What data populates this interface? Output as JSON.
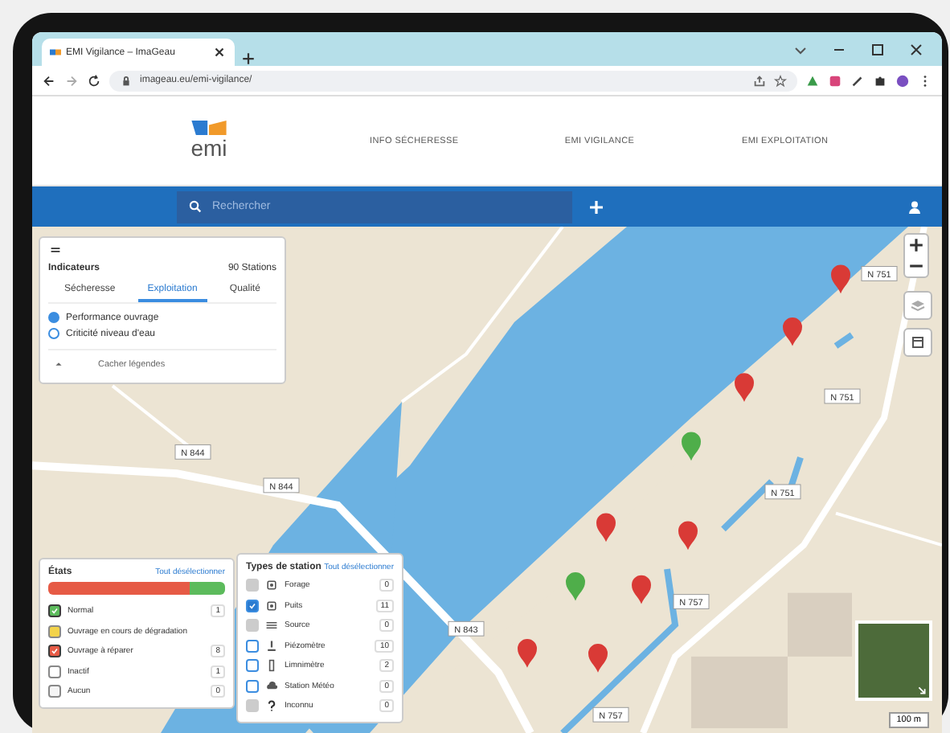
{
  "browser": {
    "tab_title": "EMI Vigilance – ImaGeau",
    "url": "imageau.eu/emi-vigilance/"
  },
  "header": {
    "logo": "emi",
    "nav": [
      "INFO SÉCHERESSE",
      "EMI VIGILANCE",
      "EMI EXPLOITATION"
    ]
  },
  "search": {
    "placeholder": "Rechercher"
  },
  "indicators": {
    "title": "Indicateurs",
    "count": "90 Stations",
    "tabs": [
      {
        "label": "Sécheresse",
        "selected": false
      },
      {
        "label": "Exploitation",
        "selected": true
      },
      {
        "label": "Qualité",
        "selected": false
      }
    ],
    "options": [
      {
        "label": "Performance ouvrage",
        "selected": true
      },
      {
        "label": "Criticité niveau d'eau",
        "selected": false
      }
    ],
    "hide_button": "Cacher légendes"
  },
  "states": {
    "title": "États",
    "action": "Tout désélectionner",
    "bar": [
      {
        "color": "#e65a45",
        "level": 0.8
      },
      {
        "color": "#5cbb5c",
        "level": 0.2
      }
    ],
    "items": [
      {
        "label": "Normal",
        "color": "#5cbb5c",
        "checked": true,
        "count": "1"
      },
      {
        "label": "Ouvrage en cours de dégradation",
        "color": "#f3d34a",
        "checked": false
      },
      {
        "label": "Ouvrage à réparer",
        "color": "#e65a45",
        "checked": true,
        "count": "8"
      },
      {
        "label": "Inactif",
        "color": "#ffffff",
        "checked": false,
        "count": "1"
      },
      {
        "label": "Aucun",
        "color": "#f4f4f4",
        "checked": false,
        "count": "0"
      }
    ]
  },
  "types": {
    "title": "Types de station",
    "action": "Tout désélectionner",
    "items": [
      {
        "kind": "borehole",
        "label": "Forage",
        "checked": false,
        "disabled": true,
        "count": "0"
      },
      {
        "kind": "well",
        "label": "Puits",
        "checked": true,
        "disabled": false,
        "count": "11"
      },
      {
        "kind": "spring",
        "label": "Source",
        "checked": false,
        "disabled": true,
        "count": "0"
      },
      {
        "kind": "piezometer",
        "label": "Piézomètre",
        "checked": false,
        "disabled": false,
        "count": "10"
      },
      {
        "kind": "gauge",
        "label": "Limnimètre",
        "checked": false,
        "disabled": false,
        "count": "2"
      },
      {
        "kind": "weather",
        "label": "Station Météo",
        "checked": false,
        "disabled": false,
        "count": "0"
      },
      {
        "kind": "unknown",
        "label": "Inconnu",
        "checked": false,
        "disabled": true,
        "count": "0"
      }
    ]
  },
  "map": {
    "markers": [
      {
        "color": "#d93a36"
      },
      {
        "color": "#d93a36"
      },
      {
        "color": "#d93a36"
      },
      {
        "color": "#4fae4a"
      },
      {
        "color": "#d93a36"
      },
      {
        "color": "#d93a36"
      },
      {
        "color": "#4fae4a"
      },
      {
        "color": "#d93a36"
      },
      {
        "color": "#d93a36"
      },
      {
        "color": "#d93a36"
      }
    ],
    "road_labels": [
      "N 751",
      "N 751",
      "N 751",
      "N 757",
      "N 757",
      "N 844",
      "N 844",
      "N 843"
    ],
    "scale": "100 m"
  }
}
